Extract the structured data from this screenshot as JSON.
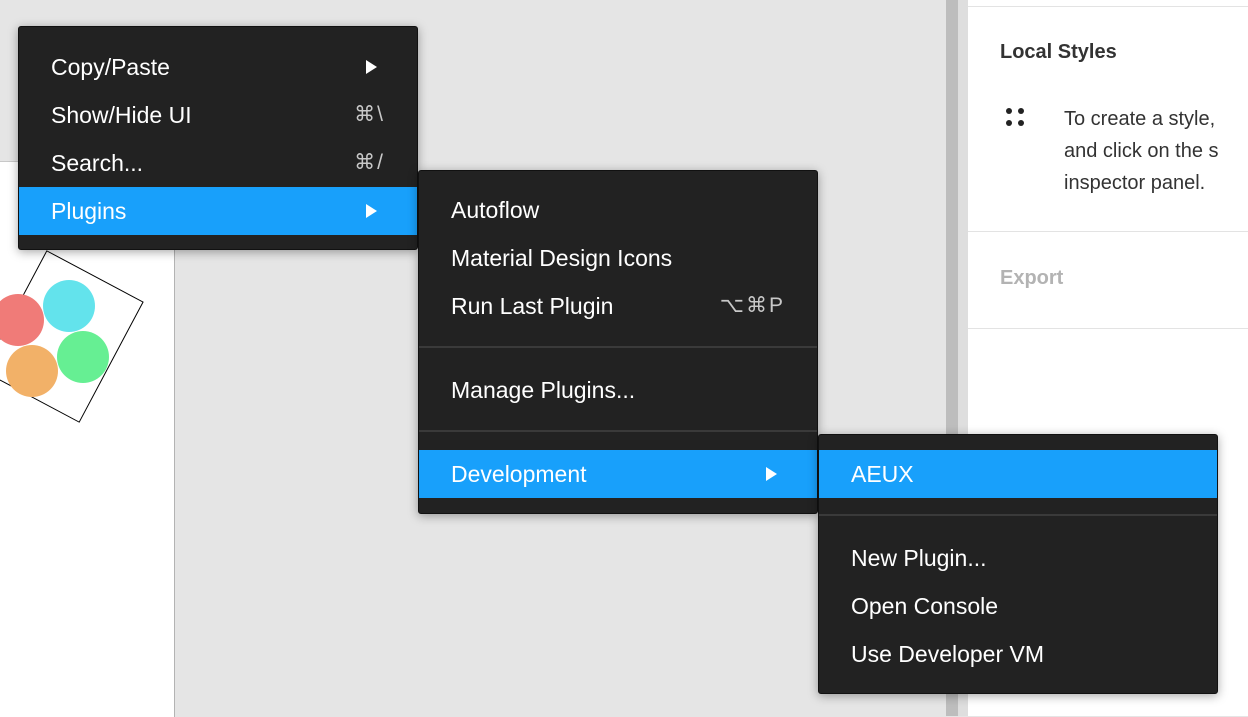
{
  "right_panel": {
    "local_styles_title": "Local Styles",
    "local_styles_text_line1": "To create a style,",
    "local_styles_text_line2": "and click on the s",
    "local_styles_text_line3": "inspector panel.",
    "export_label": "Export"
  },
  "canvas": {
    "dot_colors": [
      "#f07b78",
      "#63e3ec",
      "#f2b168",
      "#66ef93"
    ]
  },
  "main_menu": {
    "items": [
      {
        "label": "Copy/Paste",
        "shortcut": ""
      },
      {
        "label": "Show/Hide UI",
        "shortcut": "⌘\\"
      },
      {
        "label": "Search...",
        "shortcut": "⌘/"
      },
      {
        "label": "Plugins",
        "shortcut": ""
      }
    ]
  },
  "plugins_menu": {
    "items": [
      {
        "label": "Autoflow",
        "shortcut": ""
      },
      {
        "label": "Material Design Icons",
        "shortcut": ""
      },
      {
        "label": "Run Last Plugin",
        "shortcut": "⌥⌘P"
      },
      {
        "label": "Manage Plugins...",
        "shortcut": ""
      },
      {
        "label": "Development",
        "shortcut": ""
      }
    ]
  },
  "dev_menu": {
    "items": [
      {
        "label": "AEUX"
      },
      {
        "label": "New Plugin..."
      },
      {
        "label": "Open Console"
      },
      {
        "label": "Use Developer VM"
      }
    ]
  },
  "colors": {
    "menu_bg": "#222222",
    "highlight": "#18a0fb"
  },
  "icons": {
    "submenu_arrow": "chevron-right-icon",
    "styles_icon": "styles-grid-icon"
  }
}
